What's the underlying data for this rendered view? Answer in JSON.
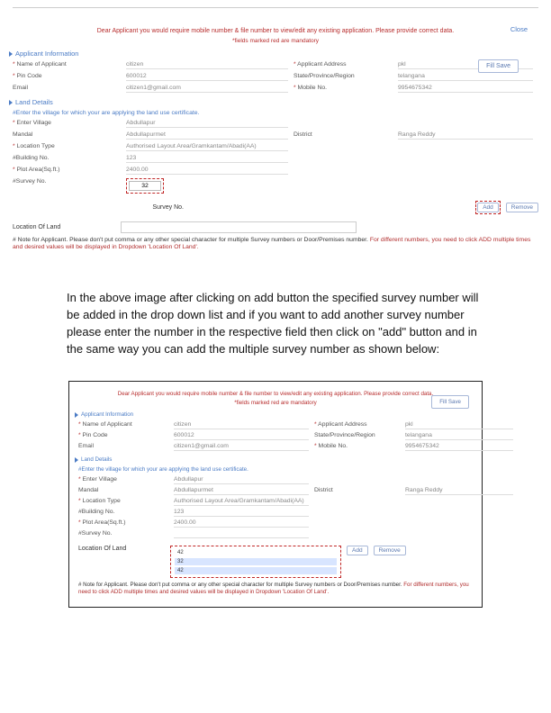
{
  "top": {
    "close": "Close",
    "warning": "Dear Applicant you would require mobile number & file number to view/edit any existing application. Please provide correct data.",
    "mandatory": "*fields marked red are mandatory",
    "fill_save": "Fill Save"
  },
  "applicant": {
    "heading": "Applicant Information",
    "name_lbl": "Name of Applicant",
    "name_val": "citizen",
    "addr_lbl": "Applicant Address",
    "addr_val": "pkl",
    "pin_lbl": "Pin Code",
    "pin_val": "600012",
    "state_lbl": "State/Province/Region",
    "state_val": "telangana",
    "email_lbl": "Email",
    "email_val": "citizen1@gmail.com",
    "mob_lbl": "Mobile No.",
    "mob_val": "9954675342"
  },
  "land": {
    "heading": "Land Details",
    "note": "#Enter the village for which your are applying the land use certificate.",
    "village_lbl": "Enter Village",
    "village_val": "Abdullapur",
    "mandal_lbl": "Mandal",
    "mandal_val": "Abdullapurmet",
    "district_lbl": "District",
    "district_val": "Ranga Reddy",
    "loctype_lbl": "Location Type",
    "loctype_val": "Authorised Layout Area/Gramkantam/Abadi(AA)",
    "building_lbl": "Building No.",
    "building_val": "123",
    "plot_lbl": "Plot Area(Sq.ft.)",
    "plot_val": "2400.00",
    "survey_lbl": "Survey No.",
    "survey_field_val": "32",
    "survey_label_inline": "Survey No.",
    "add": "Add",
    "remove": "Remove",
    "loc_land": "Location Of Land",
    "applicant_note_pre": "# Note for Applicant. Please don't put comma or any other special character for multiple Survey numbers or Door/Premises number. ",
    "applicant_note_hl": "For different numbers, you need to click ADD multiple times and desired values will be displayed in Dropdown 'Location Of Land'."
  },
  "body_text": "In the above image after clicking on add button the specified survey number will be added in the drop down list and if you want to add another survey number please enter the number in the respective field then click on \"add\" button and in the same way you can add the multiple survey number as shown below:",
  "shot2": {
    "warning": "Dear Applicant you would require mobile number & file number to view/edit any existing application. Please provide correct data.",
    "survey_field_val": "",
    "dd_opts": [
      "42",
      "32",
      "42"
    ]
  }
}
